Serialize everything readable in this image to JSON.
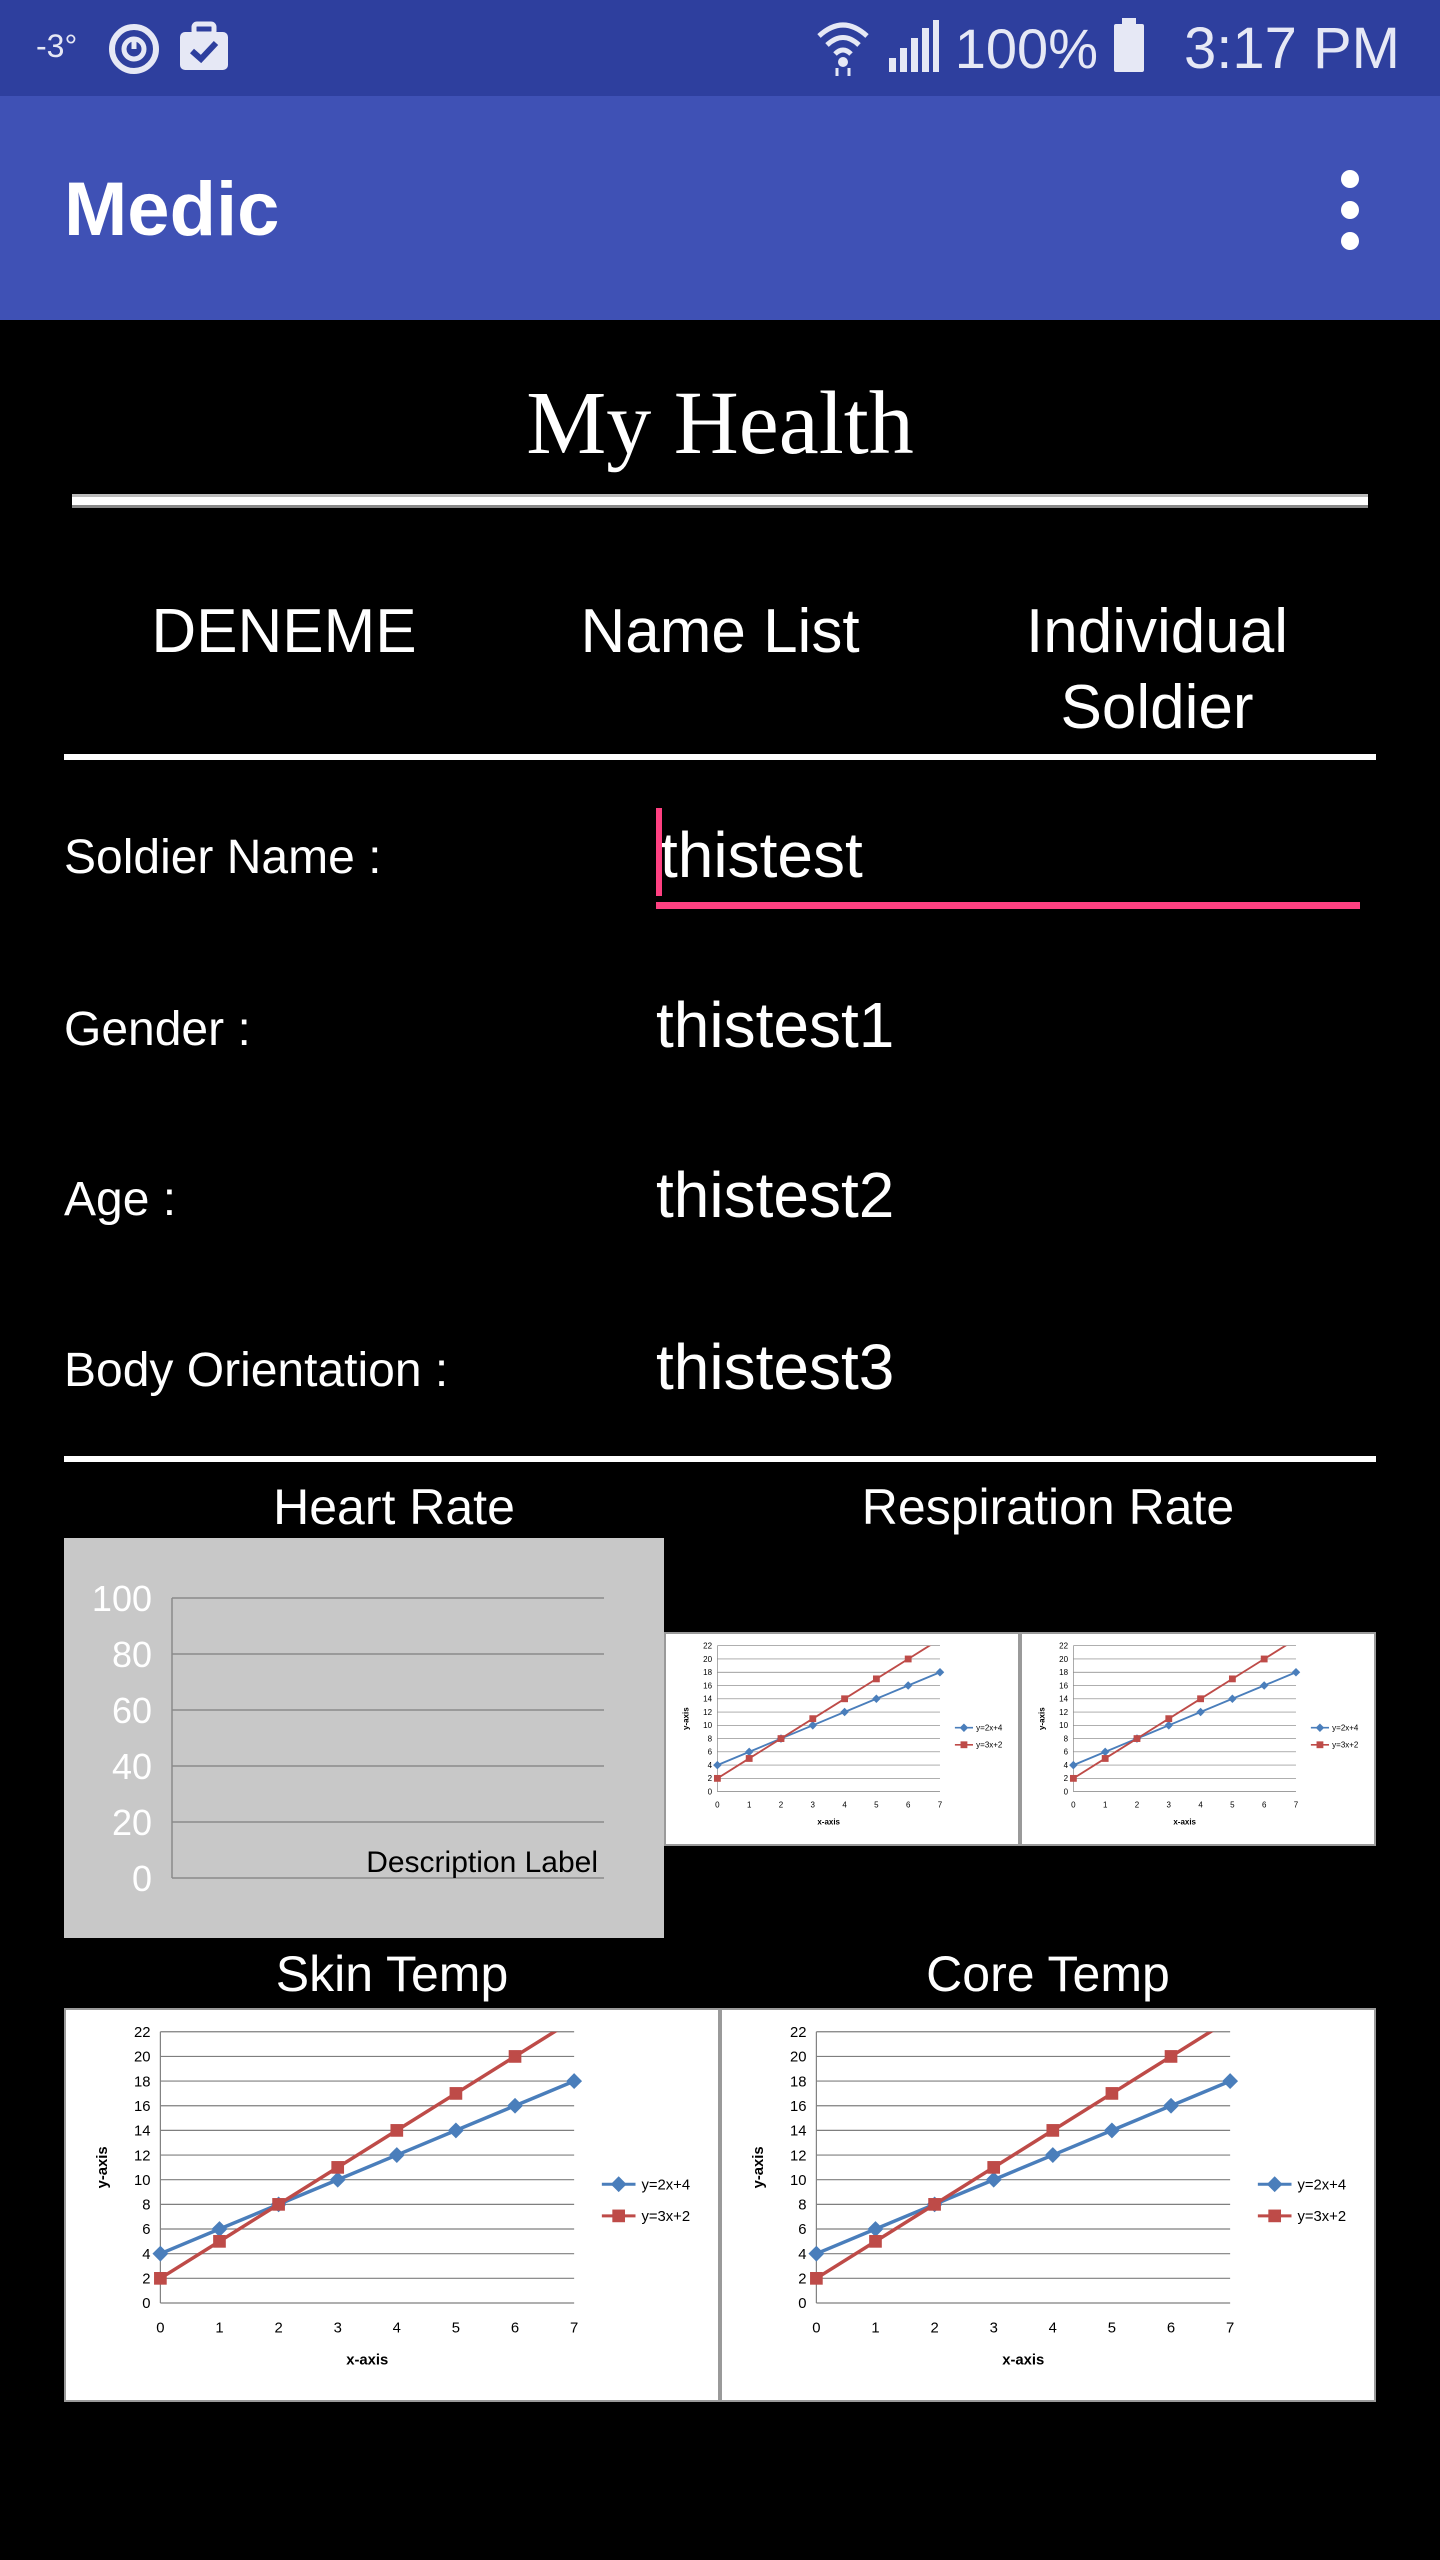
{
  "status_bar": {
    "temperature": "-3°",
    "battery": "100%",
    "time": "3:17 PM"
  },
  "app_bar": {
    "title": "Medic"
  },
  "page_title": "My Health",
  "tabs": [
    {
      "label": "DENEME"
    },
    {
      "label": "Name List"
    },
    {
      "label": "Individual Soldier"
    }
  ],
  "form": {
    "soldier_name": {
      "label": "Soldier Name :",
      "value": "thistest"
    },
    "gender": {
      "label": "Gender :",
      "value": "thistest1"
    },
    "age": {
      "label": "Age :",
      "value": "thistest2"
    },
    "body_orientation": {
      "label": "Body Orientation :",
      "value": "thistest3"
    }
  },
  "sections": {
    "heart_rate": "Heart Rate",
    "respiration_rate": "Respiration Rate",
    "skin_temp": "Skin Temp",
    "core_temp": "Core Temp"
  },
  "colors": {
    "status_bar": "#2e3f9e",
    "app_bar": "#3f51b5",
    "accent": "#ff4081",
    "series_blue": "#4a7ebb",
    "series_red": "#be4b48",
    "hr_panel": "#c8c8c8"
  },
  "icons": [
    "timer-icon",
    "briefcase-check-icon",
    "wifi-icon",
    "signal-icon",
    "battery-icon",
    "more-vert-icon"
  ],
  "chart_data": [
    {
      "type": "line",
      "name": "heart-rate-chart",
      "y_ticks": [
        "100",
        "80",
        "60",
        "40",
        "20",
        "0"
      ],
      "ylim": [
        0,
        100
      ],
      "description_label": "Description Label",
      "grid": true,
      "series": []
    },
    {
      "type": "line",
      "name": "sample-chart",
      "x": [
        0,
        1,
        2,
        3,
        4,
        5,
        6,
        7
      ],
      "xlabel": "x-axis",
      "ylabel": "y-axis",
      "ylim": [
        0,
        22
      ],
      "y_ticks": [
        "0",
        "2",
        "4",
        "6",
        "8",
        "10",
        "12",
        "14",
        "16",
        "18",
        "20",
        "22"
      ],
      "legend": "right",
      "grid": true,
      "series": [
        {
          "name": "y=2x+4",
          "color": "#4a7ebb",
          "marker": "diamond",
          "values": [
            4,
            6,
            8,
            10,
            12,
            14,
            16,
            18
          ]
        },
        {
          "name": "y=3x+2",
          "color": "#be4b48",
          "marker": "square",
          "values": [
            2,
            5,
            8,
            11,
            14,
            17,
            20,
            23
          ]
        }
      ]
    }
  ]
}
